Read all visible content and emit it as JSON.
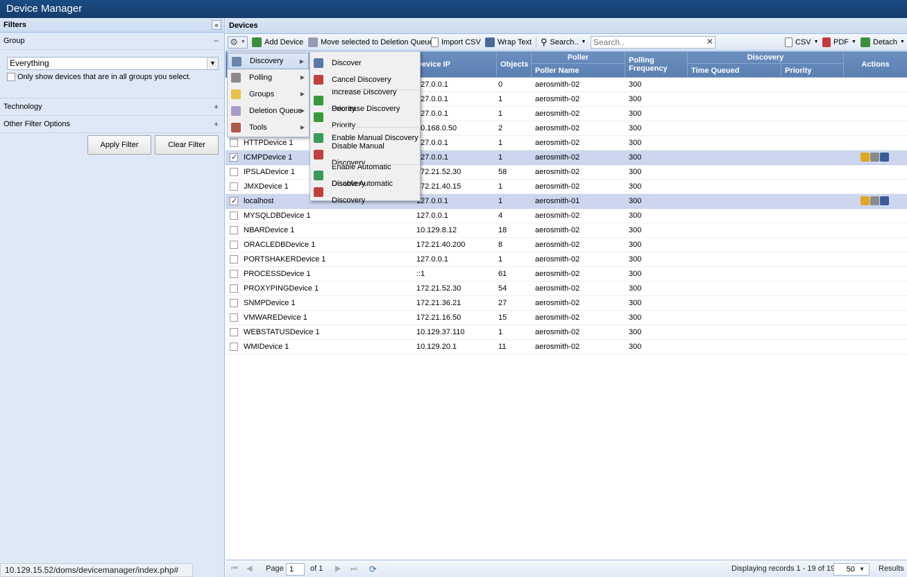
{
  "app": {
    "title": "Device Manager"
  },
  "filters": {
    "title": "Filters",
    "group_label": "Group",
    "group_value": "Everything",
    "only_show_label": "Only show devices that are in all groups you select.",
    "technology_label": "Technology",
    "other_label": "Other Filter Options",
    "apply_label": "Apply Filter",
    "clear_label": "Clear Filter",
    "minus": "−",
    "plus": "+"
  },
  "status_url": "10.129.15.52/doms/devicemanager/index.php#",
  "devices": {
    "title": "Devices",
    "toolbar": {
      "add_device": "Add Device",
      "move_deletion": "Move selected to Deletion Queue",
      "import_csv": "Import CSV",
      "wrap_text": "Wrap Text",
      "search_menu": "Search..",
      "search_placeholder": "Search..",
      "csv": "CSV",
      "pdf": "PDF",
      "detach": "Detach"
    },
    "columns": {
      "device_ip": "Device IP",
      "objects": "Objects",
      "poller": "Poller",
      "poller_name": "Poller Name",
      "polling_frequency": "Polling Frequency",
      "discovery": "Discovery",
      "time_queued": "Time Queued",
      "priority": "Priority",
      "actions": "Actions"
    },
    "rows": [
      {
        "name": "",
        "ip": "127.0.0.1",
        "objects": "0",
        "poller": "aerosmith-02",
        "freq": "300",
        "checked": false
      },
      {
        "name": "",
        "ip": "127.0.0.1",
        "objects": "1",
        "poller": "aerosmith-02",
        "freq": "300",
        "checked": false
      },
      {
        "name": "",
        "ip": "127.0.0.1",
        "objects": "1",
        "poller": "aerosmith-02",
        "freq": "300",
        "checked": false
      },
      {
        "name": "",
        "ip": "10.168.0.50",
        "objects": "2",
        "poller": "aerosmith-02",
        "freq": "300",
        "checked": false
      },
      {
        "name": "HTTPDevice 1",
        "ip": "127.0.0.1",
        "objects": "1",
        "poller": "aerosmith-02",
        "freq": "300",
        "checked": false
      },
      {
        "name": "ICMPDevice 1",
        "ip": "127.0.0.1",
        "objects": "1",
        "poller": "aerosmith-02",
        "freq": "300",
        "checked": true
      },
      {
        "name": "IPSLADevice 1",
        "ip": "172.21.52.30",
        "objects": "58",
        "poller": "aerosmith-02",
        "freq": "300",
        "checked": false
      },
      {
        "name": "JMXDevice 1",
        "ip": "172.21.40.15",
        "objects": "1",
        "poller": "aerosmith-02",
        "freq": "300",
        "checked": false
      },
      {
        "name": "localhost",
        "ip": "127.0.0.1",
        "objects": "1",
        "poller": "aerosmith-01",
        "freq": "300",
        "checked": true
      },
      {
        "name": "MYSQLDBDevice 1",
        "ip": "127.0.0.1",
        "objects": "4",
        "poller": "aerosmith-02",
        "freq": "300",
        "checked": false
      },
      {
        "name": "NBARDevice 1",
        "ip": "10.129.8.12",
        "objects": "18",
        "poller": "aerosmith-02",
        "freq": "300",
        "checked": false
      },
      {
        "name": "ORACLEDBDevice 1",
        "ip": "172.21.40.200",
        "objects": "8",
        "poller": "aerosmith-02",
        "freq": "300",
        "checked": false
      },
      {
        "name": "PORTSHAKERDevice 1",
        "ip": "127.0.0.1",
        "objects": "1",
        "poller": "aerosmith-02",
        "freq": "300",
        "checked": false
      },
      {
        "name": "PROCESSDevice 1",
        "ip": "::1",
        "objects": "61",
        "poller": "aerosmith-02",
        "freq": "300",
        "checked": false
      },
      {
        "name": "PROXYPINGDevice 1",
        "ip": "172.21.52.30",
        "objects": "54",
        "poller": "aerosmith-02",
        "freq": "300",
        "checked": false
      },
      {
        "name": "SNMPDevice 1",
        "ip": "172.21.36.21",
        "objects": "27",
        "poller": "aerosmith-02",
        "freq": "300",
        "checked": false
      },
      {
        "name": "VMWAREDevice 1",
        "ip": "172.21.16.50",
        "objects": "15",
        "poller": "aerosmith-02",
        "freq": "300",
        "checked": false
      },
      {
        "name": "WEBSTATUSDevice 1",
        "ip": "10.129.37.110",
        "objects": "1",
        "poller": "aerosmith-02",
        "freq": "300",
        "checked": false
      },
      {
        "name": "WMIDevice 1",
        "ip": "10.129.20.1",
        "objects": "11",
        "poller": "aerosmith-02",
        "freq": "300",
        "checked": false
      }
    ],
    "paging": {
      "page_label": "Page",
      "page_value": "1",
      "of_label": "of 1",
      "display": "Displaying records 1 - 19 of 19",
      "per_page": "50",
      "results": "Results"
    }
  },
  "main_menu": [
    {
      "label": "Discovery",
      "icon": "discovery-icon",
      "color": "#6a86b0"
    },
    {
      "label": "Polling",
      "icon": "polling-icon",
      "color": "#8a8a8a"
    },
    {
      "label": "Groups",
      "icon": "folder-icon",
      "color": "#e8c24a"
    },
    {
      "label": "Deletion Queue",
      "icon": "trash-icon",
      "color": "#a69ac7"
    },
    {
      "label": "Tools",
      "icon": "tools-icon",
      "color": "#b05a4a"
    }
  ],
  "sub_menu": [
    {
      "label": "Discover",
      "icon": "discover-icon",
      "color": "#5a78a8"
    },
    {
      "label": "Cancel Discovery",
      "icon": "cancel-discovery-icon",
      "color": "#c04040"
    },
    {
      "label": "Increase Discovery Priority",
      "icon": "arrow-up-icon",
      "color": "#3a9a3a"
    },
    {
      "label": "Decrease Discovery Priority",
      "icon": "arrow-down-icon",
      "color": "#3a9a3a"
    },
    {
      "label": "Enable Manual Discovery",
      "icon": "enable-manual-icon",
      "color": "#3a9a5a"
    },
    {
      "label": "Disable Manual Discovery",
      "icon": "disable-manual-icon",
      "color": "#c04040"
    },
    {
      "label": "Enable Automatic Discovery",
      "icon": "enable-auto-icon",
      "color": "#3a9a5a"
    },
    {
      "label": "Disable Automatic Discovery",
      "icon": "disable-auto-icon",
      "color": "#c04040"
    }
  ]
}
